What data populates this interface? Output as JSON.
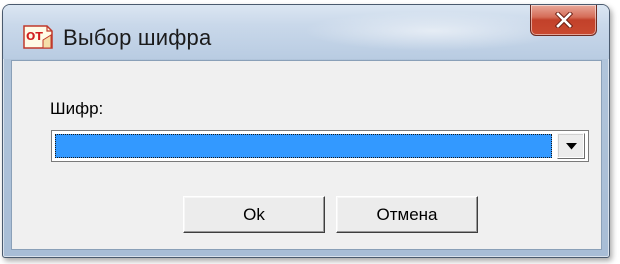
{
  "window": {
    "title": "Выбор шифра",
    "app_icon": "app-text-icon",
    "app_icon_text": "OT",
    "close_icon": "close-icon",
    "close_color": "#c94a30"
  },
  "form": {
    "cipher_label": "Шифр:",
    "cipher_value": "",
    "selection_color": "#3399ff",
    "dropdown_icon": "chevron-down-icon"
  },
  "buttons": {
    "ok_label": "Ok",
    "cancel_label": "Отмена"
  }
}
